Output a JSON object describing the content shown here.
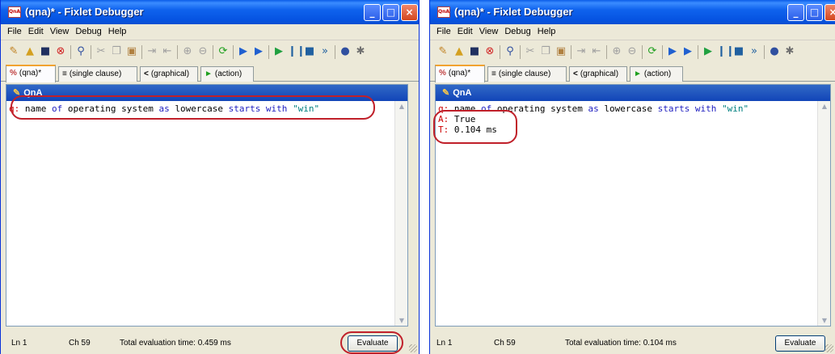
{
  "windows": [
    {
      "title": "(qna)* - Fixlet Debugger",
      "app_icon_text": "QnA",
      "menu": [
        "File",
        "Edit",
        "View",
        "Debug",
        "Help"
      ],
      "tabs": [
        {
          "icon": "%",
          "label": "(qna)*"
        },
        {
          "icon": "≡",
          "label": "(single clause)"
        },
        {
          "icon": "<",
          "label": "(graphical)"
        },
        {
          "icon": "►",
          "label": "(action)"
        }
      ],
      "panel_title": "QnA",
      "editor_line": {
        "prefix": "q:",
        "tokens": [
          " name ",
          "of",
          " operating system ",
          "as",
          " lowercase ",
          "starts with",
          " ",
          "\"win\""
        ]
      },
      "status": {
        "line": "Ln 1",
        "column": "Ch 59",
        "eval_time": "Total evaluation time: 0.459 ms",
        "evaluate_label": "Evaluate"
      }
    },
    {
      "title": "(qna)* - Fixlet Debugger",
      "app_icon_text": "QnA",
      "menu": [
        "File",
        "Edit",
        "View",
        "Debug",
        "Help"
      ],
      "tabs": [
        {
          "icon": "%",
          "label": "(qna)*"
        },
        {
          "icon": "≡",
          "label": "(single clause)"
        },
        {
          "icon": "<",
          "label": "(graphical)"
        },
        {
          "icon": "►",
          "label": "(action)"
        }
      ],
      "panel_title": "QnA",
      "editor_line": {
        "prefix": "q:",
        "tokens": [
          " name ",
          "of",
          " operating system ",
          "as",
          " lowercase ",
          "starts with",
          " ",
          "\"win\""
        ]
      },
      "answer": {
        "prefix": "A:",
        "value": " True"
      },
      "timing": {
        "prefix": "T:",
        "value": " 0.104 ms"
      },
      "status": {
        "line": "Ln 1",
        "column": "Ch 59",
        "eval_time": "Total evaluation time: 0.104 ms",
        "evaluate_label": "Evaluate"
      }
    }
  ],
  "colors": {
    "title_bar": "#0654e2",
    "tab_highlight": "#f1a330",
    "panel_header": "#1245b8",
    "keyword": "#2020c0",
    "string": "#008080",
    "prefix": "#cc0000",
    "callout": "#c0202a"
  }
}
